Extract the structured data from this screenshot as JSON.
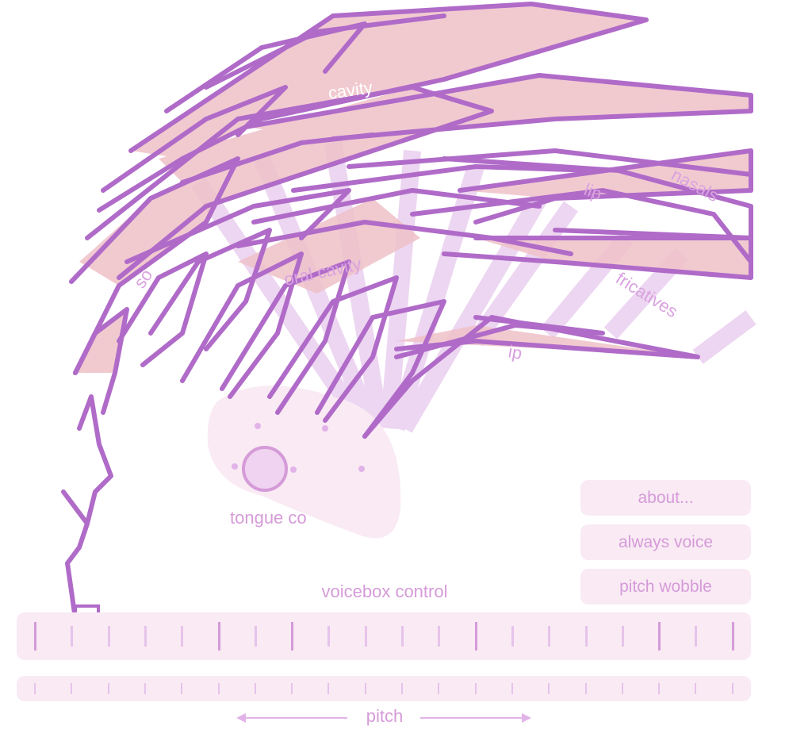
{
  "tract_labels": {
    "cavity_top": "cavity",
    "oral_cavity": "oral cavity",
    "nasals": "nasals",
    "fricatives": "fricatives",
    "soft_palate": "so",
    "lip": "lip",
    "stop": "ip"
  },
  "tongue_control": {
    "label": "tongue co"
  },
  "buttons": {
    "about": "about...",
    "always_voice": "always voice",
    "pitch_wobble": "pitch wobble"
  },
  "voicebox": {
    "label": "voicebox control",
    "key_count": 20,
    "selected_key_index": 1
  },
  "pitch": {
    "label": "pitch"
  },
  "colors": {
    "accent": "#b06bc8",
    "fill_pink": "#efc1c8",
    "panel": "#f9eaf4",
    "text": "#d59bd8"
  }
}
